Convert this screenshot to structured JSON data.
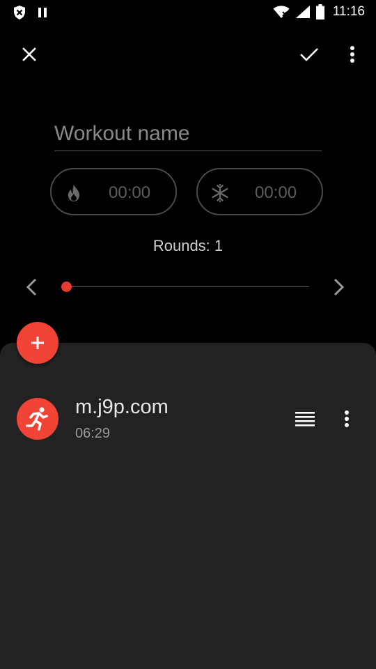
{
  "status_bar": {
    "time": "11:16",
    "left_icons": [
      "shield-x-icon",
      "pause-icon"
    ],
    "right_icons": [
      "wifi-icon",
      "signal-icon",
      "battery-icon"
    ]
  },
  "toolbar": {
    "close_icon": "close-icon",
    "confirm_icon": "check-icon",
    "more_icon": "more-vert-icon"
  },
  "workout": {
    "name_placeholder": "Workout name",
    "name_value": "",
    "warmup_time": "00:00",
    "cooldown_time": "00:00",
    "rounds_label": "Rounds: 1"
  },
  "round_slider": {
    "current": 1,
    "min": 1,
    "level": 0
  },
  "exercises": [
    {
      "name": "m.j9p.com",
      "duration": "06:29",
      "icon": "run-icon"
    }
  ],
  "colors": {
    "background": "#000000",
    "sheet": "#222222",
    "accent": "#f14436",
    "muted_text": "#5d5d5d"
  }
}
